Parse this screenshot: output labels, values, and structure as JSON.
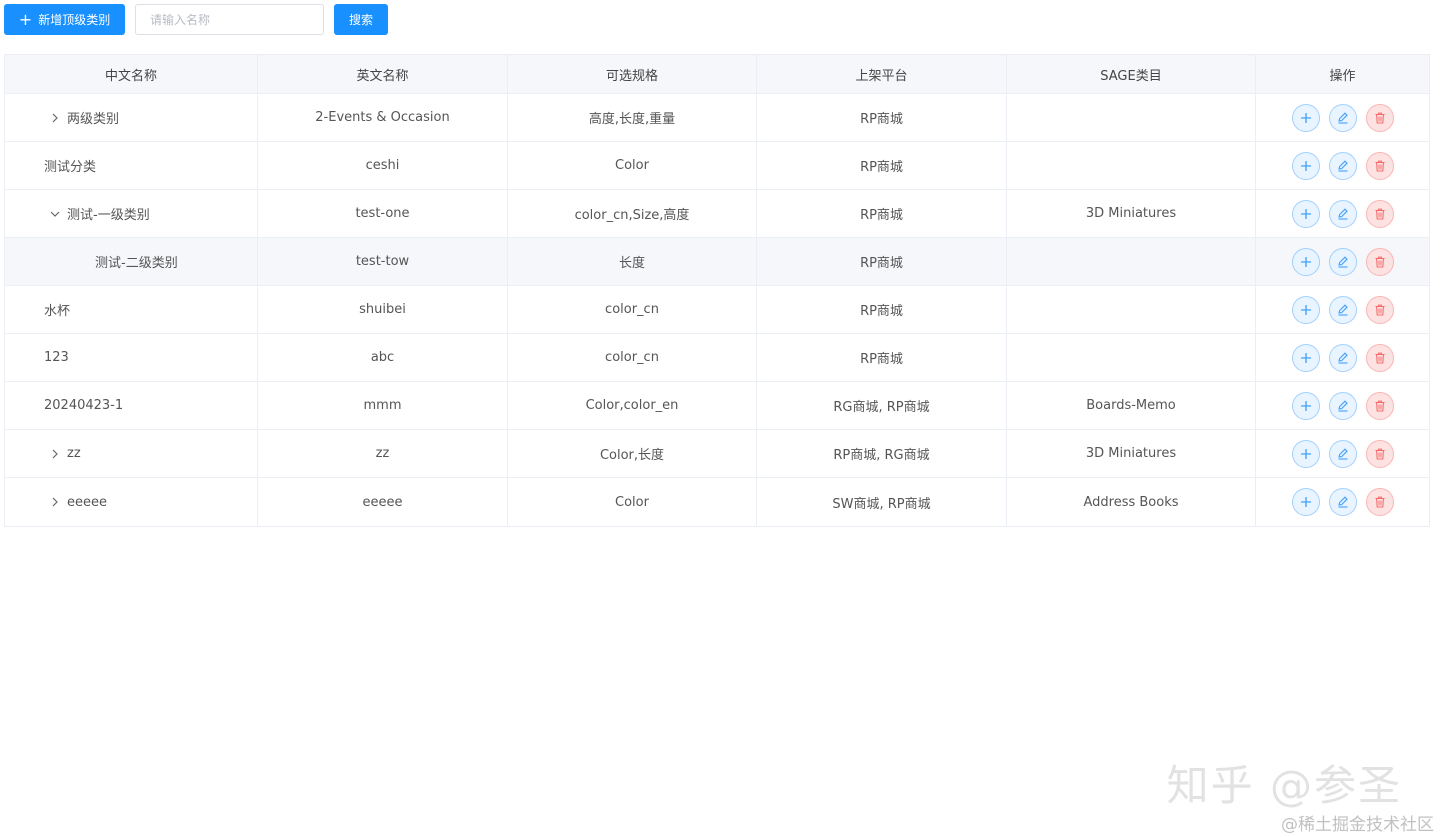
{
  "toolbar": {
    "add_label": "新增顶级类别",
    "search_placeholder": "请输入名称",
    "search_label": "搜索"
  },
  "table": {
    "columns": [
      "中文名称",
      "英文名称",
      "可选规格",
      "上架平台",
      "SAGE类目",
      "操作"
    ],
    "rows": [
      {
        "name": "两级类别",
        "en": "2-Events & Occasion",
        "spec": "高度,长度,重量",
        "platform": "RP商城",
        "sage": "",
        "toggle": "collapsed",
        "level": 0
      },
      {
        "name": "测试分类",
        "en": "ceshi",
        "spec": "Color",
        "platform": "RP商城",
        "sage": "",
        "toggle": "none",
        "level": 0
      },
      {
        "name": "测试-一级类别",
        "en": "test-one",
        "spec": "color_cn,Size,高度",
        "platform": "RP商城",
        "sage": "3D Miniatures",
        "toggle": "expanded",
        "level": 0
      },
      {
        "name": "测试-二级类别",
        "en": "test-tow",
        "spec": "长度",
        "platform": "RP商城",
        "sage": "",
        "toggle": "none",
        "level": 1
      },
      {
        "name": "水杯",
        "en": "shuibei",
        "spec": "color_cn",
        "platform": "RP商城",
        "sage": "",
        "toggle": "none",
        "level": 0
      },
      {
        "name": "123",
        "en": "abc",
        "spec": "color_cn",
        "platform": "RP商城",
        "sage": "",
        "toggle": "none",
        "level": 0
      },
      {
        "name": "20240423-1",
        "en": "mmm",
        "spec": "Color,color_en",
        "platform": "RG商城, RP商城",
        "sage": "Boards-Memo",
        "toggle": "none",
        "level": 0
      },
      {
        "name": "zz",
        "en": "zz",
        "spec": "Color,长度",
        "platform": "RP商城, RG商城",
        "sage": "3D Miniatures",
        "toggle": "collapsed",
        "level": 0
      },
      {
        "name": "eeeee",
        "en": "eeeee",
        "spec": "Color",
        "platform": "SW商城, RP商城",
        "sage": "Address Books",
        "toggle": "collapsed",
        "level": 0
      }
    ]
  },
  "watermark": {
    "main": "知乎 @参圣",
    "sub": "@稀土掘金技术社区"
  },
  "colors": {
    "primary": "#1890ff",
    "border": "#ebeef5",
    "header_bg": "#f5f7fa",
    "danger": "#f56c6c"
  }
}
